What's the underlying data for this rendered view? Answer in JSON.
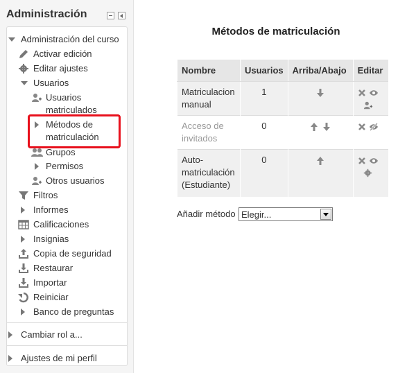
{
  "sidebar": {
    "title": "Administración",
    "items": {
      "admin_curso": "Administración del curso",
      "activar_edicion": "Activar edición",
      "editar_ajustes": "Editar ajustes",
      "usuarios": "Usuarios",
      "usuarios_matriculados_1": "Usuarios",
      "usuarios_matriculados_2": "matriculados",
      "metodos_1": "Métodos de",
      "metodos_2": "matriculación",
      "grupos": "Grupos",
      "permisos": "Permisos",
      "otros_usuarios": "Otros usuarios",
      "filtros": "Filtros",
      "informes": "Informes",
      "calificaciones": "Calificaciones",
      "insignias": "Insignias",
      "copia_seguridad": "Copia de seguridad",
      "restaurar": "Restaurar",
      "importar": "Importar",
      "reiniciar": "Reiniciar",
      "banco_preguntas": "Banco de preguntas",
      "cambiar_rol": "Cambiar rol a...",
      "ajustes_perfil": "Ajustes de mi perfil"
    }
  },
  "main": {
    "title": "Métodos de matriculación",
    "table": {
      "headers": [
        "Nombre",
        "Usuarios",
        "Arriba/Abajo",
        "Editar"
      ],
      "rows": [
        {
          "name_lines": [
            "Matriculacion",
            "manual"
          ],
          "users": "1"
        },
        {
          "name_lines": [
            "Acceso de",
            "invitados"
          ],
          "users": "0"
        },
        {
          "name_lines": [
            "Auto-",
            "matriculación",
            "(Estudiante)"
          ],
          "users": "0"
        }
      ]
    },
    "add_method": {
      "label": "Añadir método",
      "selected": "Elegir..."
    }
  }
}
